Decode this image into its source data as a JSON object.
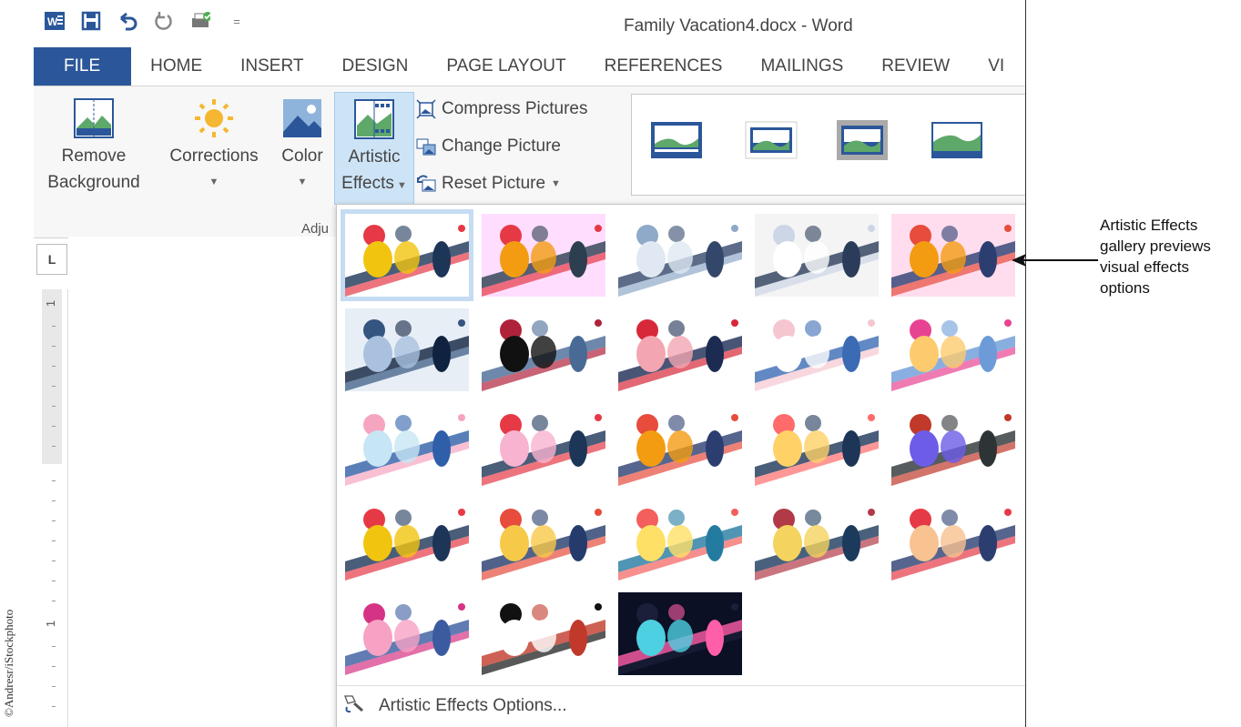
{
  "credit": "©Andresr/iStockphoto",
  "window_title": "Family Vacation4.docx - Word",
  "qat": {
    "icons": [
      "word-icon",
      "save-icon",
      "undo-icon",
      "redo-icon",
      "print-preview-icon"
    ],
    "more": "="
  },
  "tabs": [
    "FILE",
    "HOME",
    "INSERT",
    "DESIGN",
    "PAGE LAYOUT",
    "REFERENCES",
    "MAILINGS",
    "REVIEW",
    "VI"
  ],
  "ribbon": {
    "remove_background": [
      "Remove",
      "Background"
    ],
    "corrections": "Corrections",
    "color": "Color",
    "artistic_effects": [
      "Artistic",
      "Effects"
    ],
    "compress": "Compress Pictures",
    "change": "Change Picture",
    "reset": "Reset Picture",
    "group_label": "Adju"
  },
  "ruler": {
    "corner": "L",
    "marks": [
      "1",
      "1"
    ]
  },
  "gallery": {
    "rows": 5,
    "cols": 5,
    "count": 23,
    "selected_index": 0,
    "options_label": "Artistic Effects Options..."
  },
  "annotation": "Artistic Effects gallery previews visual effects options",
  "colors": {
    "accent": "#2b579a",
    "highlight": "#cde4f7"
  }
}
